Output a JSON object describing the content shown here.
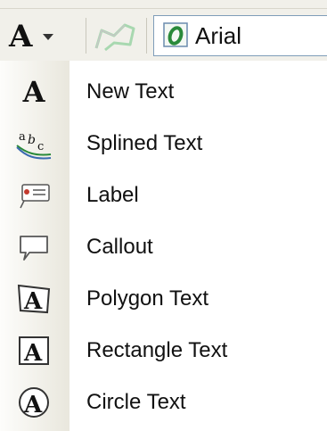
{
  "toolbar": {
    "text_tool_icon": "text-A-icon",
    "edit_text_icon": "edit-vertices-icon",
    "font_icon": "opentype-font-icon",
    "font_name": "Arial"
  },
  "menu": {
    "items": [
      {
        "label": "New Text",
        "icon": "new-text-icon"
      },
      {
        "label": "Splined Text",
        "icon": "splined-text-icon"
      },
      {
        "label": "Label",
        "icon": "label-icon"
      },
      {
        "label": "Callout",
        "icon": "callout-icon"
      },
      {
        "label": "Polygon Text",
        "icon": "polygon-text-icon"
      },
      {
        "label": "Rectangle Text",
        "icon": "rectangle-text-icon"
      },
      {
        "label": "Circle Text",
        "icon": "circle-text-icon"
      }
    ]
  },
  "colors": {
    "toolbar_bg": "#f1f0ea",
    "gutter_bg": "#e9e7dd",
    "combo_border": "#7f9db9",
    "font_icon_green": "#2a8a3a"
  }
}
